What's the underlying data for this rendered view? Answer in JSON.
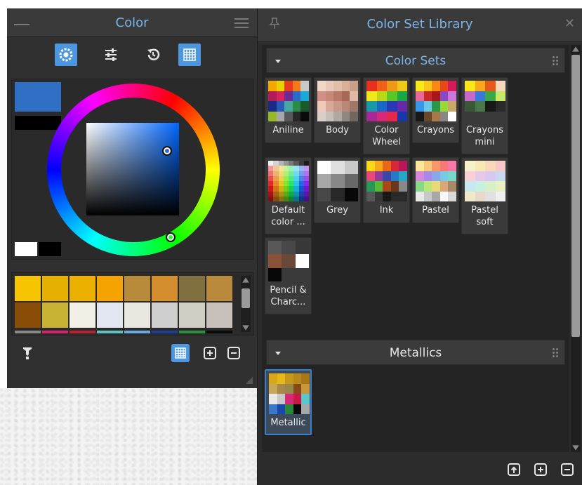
{
  "color_panel": {
    "title": "Color",
    "modes": [
      "wheel-mode-icon",
      "sliders-mode-icon",
      "history-mode-icon",
      "palette-mode-icon"
    ],
    "primary_color": "#2f6fc4",
    "secondary_color": "#000000",
    "palette_row1": [
      "#f6c400",
      "#e5b000",
      "#ecb100",
      "#f5a300",
      "#b88b3a",
      "#d48e2e",
      "#807040",
      "#b98a3c"
    ],
    "palette_row2": [
      "#8a4d08",
      "#c8b334",
      "#f2efe6",
      "#e2e6f0",
      "#e9e7df",
      "#cfcfcf",
      "#d0cdc2",
      "#c7c0bb"
    ],
    "palette_strip": [
      "#888888",
      "#d6226a",
      "#b82034",
      "#5ec2c0",
      "#6aa9e0",
      "#1e3e9c",
      "#2d8f3a",
      "#0a0a0a"
    ]
  },
  "library_panel": {
    "title": "Color Set Library",
    "sections": [
      {
        "title": "Color Sets",
        "items": [
          {
            "label": "Aniline"
          },
          {
            "label": "Body"
          },
          {
            "label": "Color Wheel"
          },
          {
            "label": "Crayons"
          },
          {
            "label": "Crayons mini"
          },
          {
            "label": "Default color ..."
          },
          {
            "label": "Grey"
          },
          {
            "label": "Ink"
          },
          {
            "label": "Pastel"
          },
          {
            "label": "Pastel soft"
          },
          {
            "label": "Pencil & Charc..."
          }
        ]
      },
      {
        "title": "Metallics",
        "items": [
          {
            "label": "Metallic",
            "selected": true
          }
        ]
      }
    ]
  }
}
